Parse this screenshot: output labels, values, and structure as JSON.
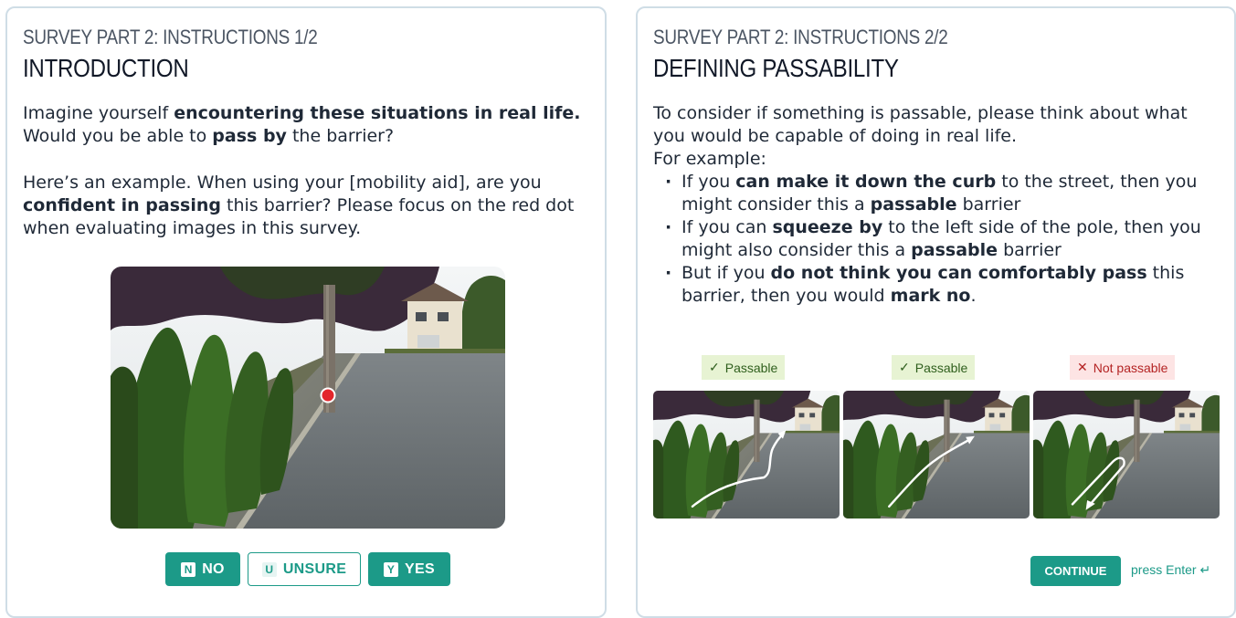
{
  "left": {
    "part_label": "SURVEY PART 2: INSTRUCTIONS 1/2",
    "title": "INTRODUCTION",
    "p1": {
      "t1": "Imagine yourself ",
      "b1": "encountering these situations in real life.",
      "t2": " Would you be able to ",
      "b2": "pass by",
      "t3": " the barrier?"
    },
    "p2": {
      "t1": "Here’s an example. When using your [mobility aid], are you ",
      "b1": "confident in passing",
      "t2": " this barrier? Please focus on the red dot when evaluating images in this survey."
    },
    "buttons": {
      "no": {
        "key": "N",
        "label": "NO"
      },
      "unsure": {
        "key": "U",
        "label": "UNSURE"
      },
      "yes": {
        "key": "Y",
        "label": "YES"
      }
    }
  },
  "right": {
    "part_label": "SURVEY PART 2: INSTRUCTIONS 2/2",
    "title": "DEFINING PASSABILITY",
    "intro": "To consider if something is passable, please think about what you would be capable of doing in real life.",
    "for_example": "For example:",
    "bullets": [
      {
        "t1": "If you ",
        "b1": "can make it down the curb",
        "t2": " to the street, then you might consider this a ",
        "b2": "passable",
        "t3": " barrier"
      },
      {
        "t1": "If you can ",
        "b1": "squeeze by",
        "t2": " to the left side of the pole, then you might also consider this a ",
        "b2": "passable",
        "t3": " barrier"
      },
      {
        "t1": "But if you ",
        "b1": "do not think you can comfortably pass",
        "t2": " this barrier, then you would ",
        "b2": "mark no",
        "t3": "."
      }
    ],
    "tags": [
      {
        "icon": "✓",
        "label": "Passable"
      },
      {
        "icon": "✓",
        "label": "Passable"
      },
      {
        "icon": "✕",
        "label": "Not passable"
      }
    ],
    "continue_label": "CONTINUE",
    "enter_hint": "press Enter ↵"
  }
}
